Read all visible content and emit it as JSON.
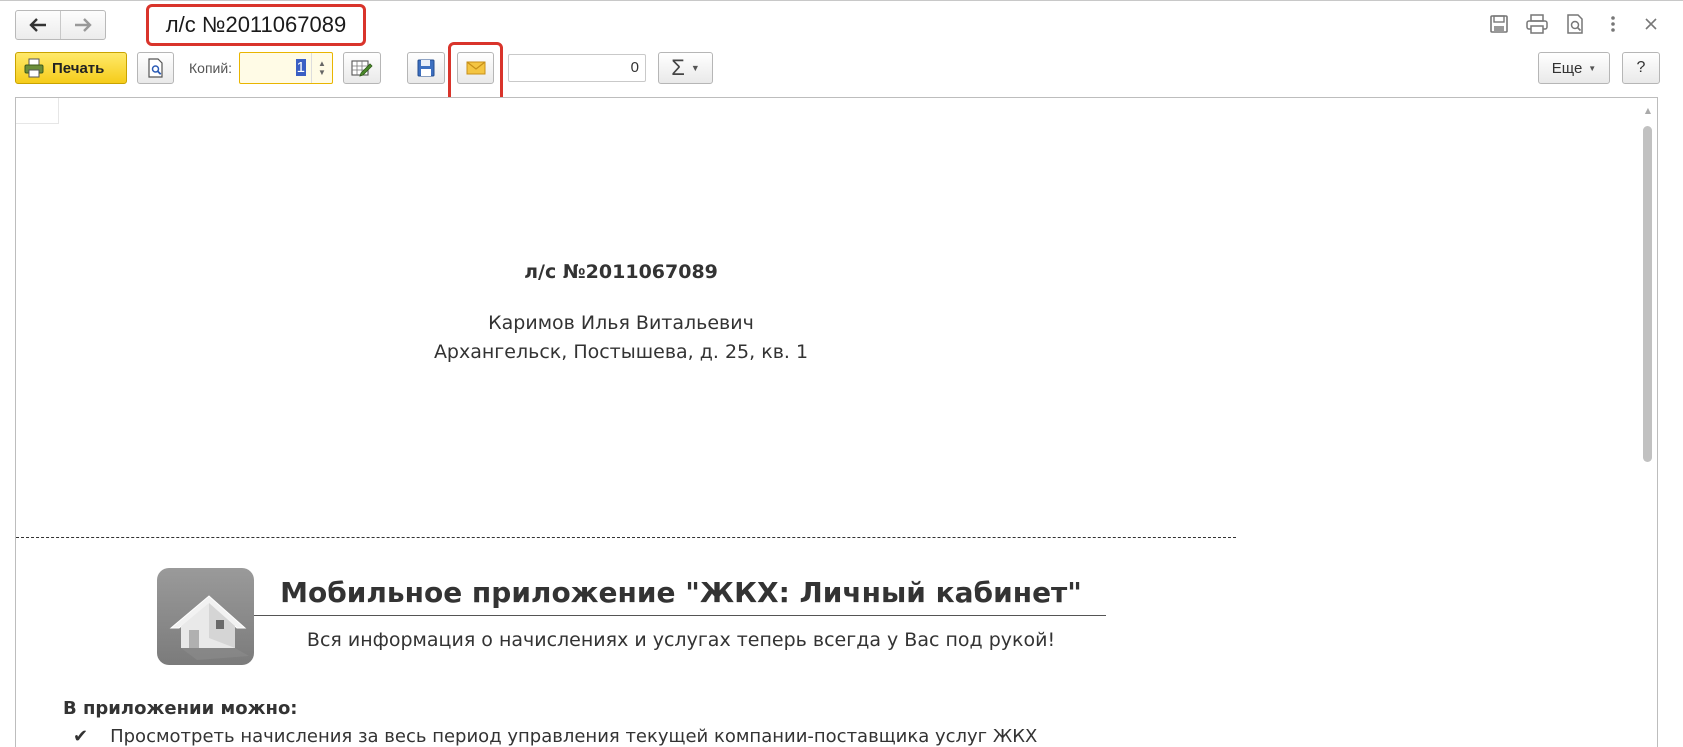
{
  "window": {
    "title": "л/с №2011067089",
    "nav": {
      "back_icon": "arrow-left-icon",
      "forward_icon": "arrow-right-icon"
    },
    "icons": [
      "save-icon",
      "print-icon",
      "preview-icon",
      "more-vertical-icon",
      "close-icon"
    ]
  },
  "toolbar": {
    "print_label": "Печать",
    "copies_label": "Копий:",
    "copies_value": "1",
    "number_value": "0",
    "sum_label": "Σ",
    "more_label": "Еще",
    "help_label": "?"
  },
  "document": {
    "account": "л/с №2011067089",
    "owner": "Каримов Илья Витальевич",
    "address": "Архангельск, Постышева, д. 25, кв. 1",
    "promo": {
      "title": "Мобильное приложение \"ЖКХ: Личный кабинет\"",
      "subtitle": "Вся информация о начислениях и услугах теперь всегда у Вас под рукой!",
      "features_title": "В приложении можно:",
      "features": [
        "Просмотреть начисления за весь период управления текущей компании-поставщика услуг ЖКХ"
      ]
    }
  },
  "colors": {
    "highlight": "#d9342b",
    "print_button": "#f5cc1a",
    "selection": "#3b5fc4"
  }
}
